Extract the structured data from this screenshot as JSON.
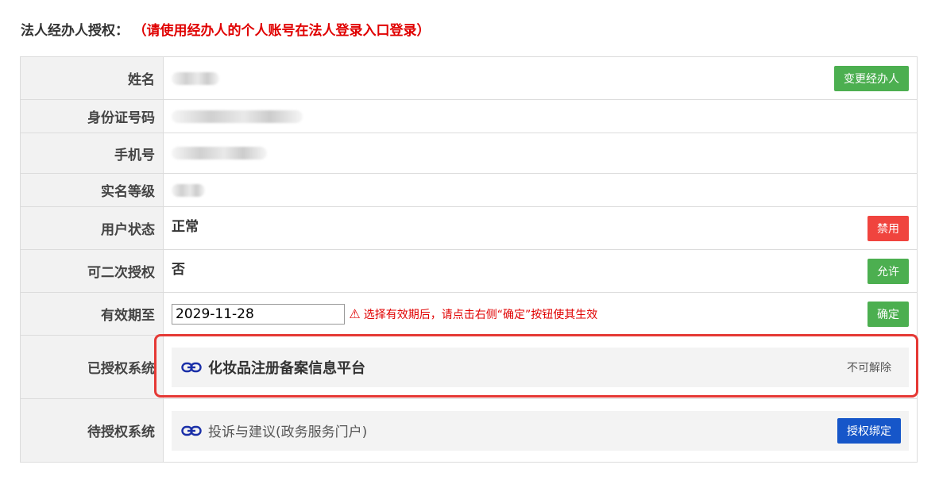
{
  "header": {
    "title": "法人经办人授权：",
    "note": "（请使用经办人的个人账号在法人登录入口登录）"
  },
  "rows": {
    "name": {
      "label": "姓名",
      "button": "变更经办人"
    },
    "id_number": {
      "label": "身份证号码"
    },
    "phone": {
      "label": "手机号"
    },
    "real_name_level": {
      "label": "实名等级"
    },
    "user_status": {
      "label": "用户状态",
      "value": "正常",
      "button": "禁用"
    },
    "secondary_auth": {
      "label": "可二次授权",
      "value": "否",
      "button": "允许"
    },
    "valid_until": {
      "label": "有效期至",
      "value": "2029-11-28",
      "hint": "选择有效期后，请点击右侧“确定”按钮使其生效",
      "button": "确定"
    },
    "authorized_systems": {
      "label": "已授权系统",
      "items": [
        {
          "name": "化妆品注册备案信息平台",
          "status": "不可解除"
        }
      ]
    },
    "pending_systems": {
      "label": "待授权系统",
      "items": [
        {
          "name": "投诉与建议(政务服务门户)",
          "button": "授权绑定"
        }
      ]
    }
  },
  "colors": {
    "green_button": "#4caf50",
    "red_button": "#f0443e",
    "blue_button": "#1656c9",
    "warning_red": "#e00000",
    "link_icon_blue": "#1a2fa8"
  }
}
